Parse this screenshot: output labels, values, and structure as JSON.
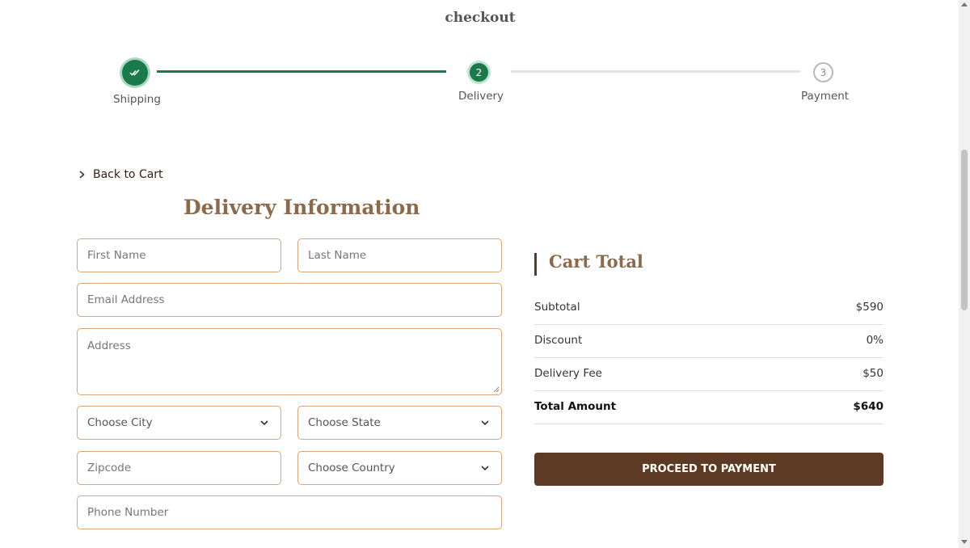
{
  "page": {
    "title": "checkout"
  },
  "stepper": {
    "steps": [
      {
        "label": "Shipping",
        "number": "",
        "status": "completed",
        "icon": "double-check-icon"
      },
      {
        "label": "Delivery",
        "number": "2",
        "status": "active"
      },
      {
        "label": "Payment",
        "number": "3",
        "status": "pending"
      }
    ],
    "colors": {
      "done": "#1a7a4c",
      "pending": "#e2e2e2"
    }
  },
  "nav": {
    "back_label": "Back to Cart"
  },
  "form": {
    "title": "Delivery Information",
    "first_name": {
      "placeholder": "First Name"
    },
    "last_name": {
      "placeholder": "Last Name"
    },
    "email": {
      "placeholder": "Email Address"
    },
    "address": {
      "placeholder": "Address"
    },
    "city": {
      "selected": "Choose City"
    },
    "state": {
      "selected": "Choose State"
    },
    "zipcode": {
      "placeholder": "Zipcode"
    },
    "country": {
      "selected": "Choose Country"
    },
    "phone": {
      "placeholder": "Phone Number"
    }
  },
  "cart": {
    "title": "Cart Total",
    "rows": [
      {
        "label": "Subtotal",
        "value": "$590"
      },
      {
        "label": "Discount",
        "value": "0%"
      },
      {
        "label": "Delivery Fee",
        "value": "$50"
      },
      {
        "label": "Total Amount",
        "value": "$640"
      }
    ],
    "button_label": "PROCEED TO PAYMENT"
  },
  "theme": {
    "accent": "#5c3a24",
    "heading": "#8a6a4a",
    "border": "#d9a679",
    "success": "#1a7a4c"
  }
}
